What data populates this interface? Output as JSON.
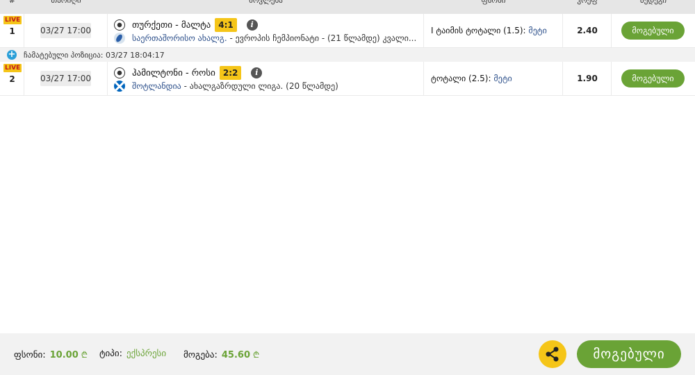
{
  "table": {
    "headers": [
      "#",
      "თარიღი",
      "მოვლენა",
      "ფსონი",
      "კოეფ",
      "შედეგი"
    ]
  },
  "rows": [
    {
      "live": "LIVE",
      "number": "1",
      "date": "03/27 17:00",
      "teams": "თურქეთი - მალტა",
      "score": "4:1",
      "league_link": "საერთაშორისო ახალგ.",
      "league_rest": " - ევროპის ჩემპიონატი - (21 წლამდე) კვალი...",
      "market": "I ტაიმის ტოტალი (1.5): ",
      "selection": "მეტი",
      "odd": "2.40",
      "result": "მოგებული"
    },
    {
      "live": "LIVE",
      "number": "2",
      "date": "03/27 17:00",
      "teams": "ჰამილტონი - როსი",
      "score": "2:2",
      "league_link": "შოტლანდია",
      "league_rest": " - ახალგაზრდული ლიგა. (20 წლამდე)",
      "market": "ტოტალი (2.5): ",
      "selection": "მეტი",
      "odd": "1.90",
      "result": "მოგებული"
    }
  ],
  "added_position": "ჩამატებული პოზიცია: 03/27 18:04:17",
  "footer": {
    "stake_label": "ფსონი:",
    "stake_value": "10.00",
    "type_label": "ტიპი:",
    "type_value": "ექსპრესი",
    "win_label": "მოგება:",
    "win_value": "45.60",
    "currency": "₾",
    "status_button": "მოგებული"
  },
  "icons": {
    "share": "share-icon",
    "sport": "soccer-ball-icon",
    "info": "info-icon",
    "add": "plus-circle-icon"
  },
  "colors": {
    "accent_green": "#6aa336",
    "live_yellow": "#f5c518",
    "link_blue": "#2c4f8a"
  }
}
